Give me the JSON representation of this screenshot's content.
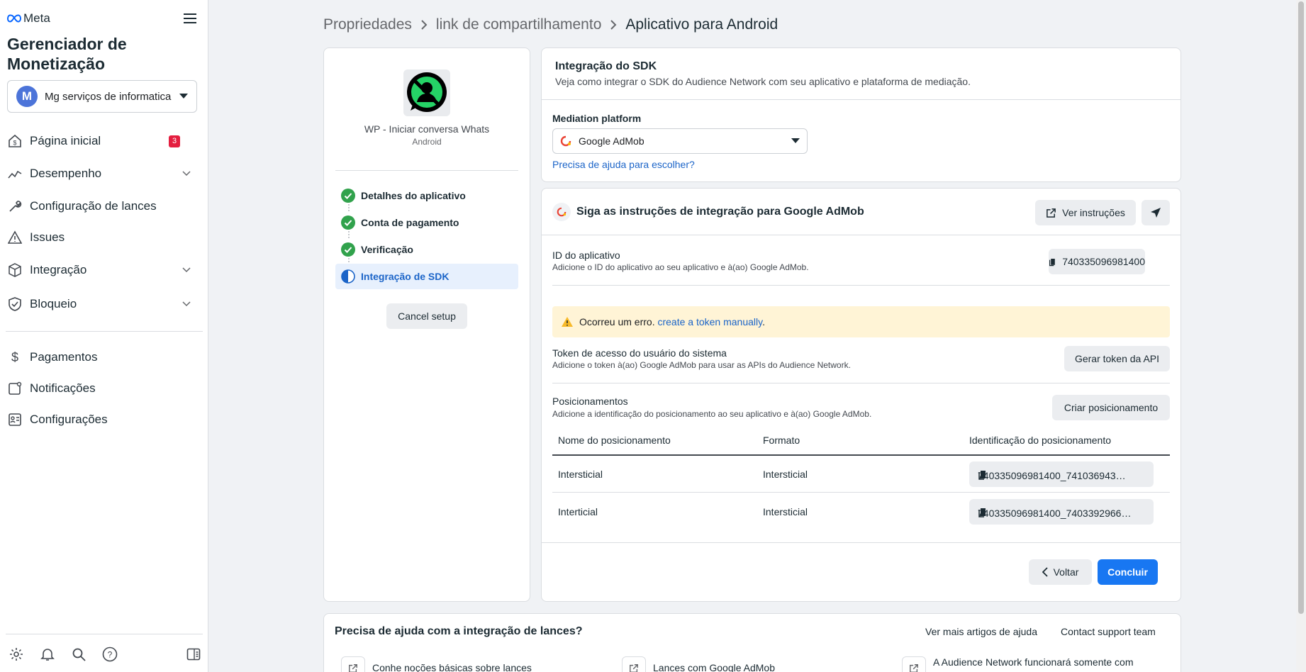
{
  "sidebar": {
    "brand": "Meta",
    "app_title": "Gerenciador de Monetização",
    "account": {
      "initial": "M",
      "name": "Mg serviços de informatica"
    },
    "nav": [
      {
        "label": "Página inicial",
        "icon": "home-dollar-icon",
        "badge": "3"
      },
      {
        "label": "Desempenho",
        "icon": "chart-line-icon",
        "expandable": true
      },
      {
        "label": "Configuração de lances",
        "icon": "wrench-icon"
      },
      {
        "label": "Issues",
        "icon": "warning-icon"
      },
      {
        "label": "Integração",
        "icon": "cube-icon",
        "expandable": true
      },
      {
        "label": "Bloqueio",
        "icon": "shield-check-icon",
        "expandable": true
      }
    ],
    "nav2": [
      {
        "label": "Pagamentos",
        "icon": "dollar-icon"
      },
      {
        "label": "Notificações",
        "icon": "notification-icon"
      },
      {
        "label": "Configurações",
        "icon": "settings-list-icon"
      }
    ]
  },
  "breadcrumb": {
    "items": [
      "Propriedades",
      "link de compartilhamento",
      "Aplicativo para Android"
    ]
  },
  "app_card": {
    "name": "WP - Iniciar conversa Whats",
    "platform": "Android",
    "steps": [
      {
        "label": "Detalhes do aplicativo",
        "state": "done"
      },
      {
        "label": "Conta de pagamento",
        "state": "done"
      },
      {
        "label": "Verificação",
        "state": "done"
      },
      {
        "label": "Integração de SDK",
        "state": "active"
      }
    ],
    "cancel_label": "Cancel setup"
  },
  "sdk": {
    "title": "Integração do SDK",
    "subtitle": "Veja como integrar o SDK do Audience Network com seu aplicativo e plataforma de mediação.",
    "mediation_label": "Mediation platform",
    "mediation_value": "Google AdMob",
    "help_link": "Precisa de ajuda para escolher?"
  },
  "instructions": {
    "title": "Siga as instruções de integração para Google AdMob",
    "view_label": "Ver instruções",
    "app_id_title": "ID do aplicativo",
    "app_id_sub": "Adicione o ID do aplicativo ao seu aplicativo e à(ao) Google AdMob.",
    "app_id_value": "740335096981400",
    "alert_text": "Ocorreu um erro.",
    "alert_link": "create a token manually",
    "alert_end": ".",
    "token_title": "Token de acesso do usuário do sistema",
    "token_sub": "Adicione o token à(ao) Google AdMob para usar as APIs do Audience Network.",
    "token_button": "Gerar token da API",
    "placements_title": "Posicionamentos",
    "placements_sub": "Adicione a identificação do posicionamento ao seu aplicativo e à(ao) Google AdMob.",
    "create_placement": "Criar posicionamento",
    "columns": [
      "Nome do posicionamento",
      "Formato",
      "Identificação do posicionamento"
    ],
    "rows": [
      {
        "name": "Intersticial",
        "format": "Intersticial",
        "id": "740335096981400_741036943…"
      },
      {
        "name": "Interticial",
        "format": "Intersticial",
        "id": "740335096981400_7403392966…"
      }
    ],
    "back_label": "Voltar",
    "done_label": "Concluir"
  },
  "help": {
    "title": "Precisa de ajuda com a integração de lances?",
    "more_articles": "Ver mais artigos de ajuda",
    "contact": "Contact support team",
    "articles": [
      "Conhe noções básicas sobre lances",
      "Lances com Google AdMob",
      "A Audience Network funcionará somente com"
    ]
  },
  "colors": {
    "primary": "#1877f2",
    "link": "#1b64c8",
    "success": "#31a24c",
    "badge": "#e41e3f",
    "alert_bg": "#fff4d6",
    "warning": "#f7b928"
  }
}
